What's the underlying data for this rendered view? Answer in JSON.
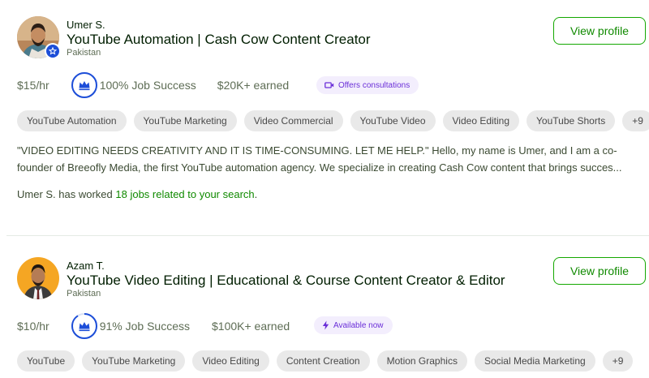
{
  "freelancers": [
    {
      "name": "Umer S.",
      "title": "YouTube Automation | Cash Cow Content Creator",
      "country": "Pakistan",
      "view_profile": "View profile",
      "rate": "$15/hr",
      "job_success": "100% Job Success",
      "earned": "$20K+ earned",
      "highlight": "Offers consultations",
      "highlight_icon": "video-icon",
      "tags": [
        "YouTube Automation",
        "YouTube Marketing",
        "Video Commercial",
        "YouTube Video",
        "Video Editing",
        "YouTube Shorts",
        "+9"
      ],
      "description_line1": "\"VIDEO EDITING NEEDS CREATIVITY AND IT IS TIME-CONSUMING. LET ME HELP.\" Hello, my name is Umer, and I am a co-",
      "description_line2": "founder of Breeofly Media, the first YouTube automation agency. We specialize in creating Cash Cow content that brings succes...",
      "worked_prefix": "Umer S. has worked ",
      "worked_link": "18 jobs related to your search",
      "worked_suffix": ".",
      "avatar_bg": "#c8a27a",
      "verified": true
    },
    {
      "name": "Azam T.",
      "title": "YouTube Video Editing | Educational & Course Content Creator & Editor",
      "country": "Pakistan",
      "view_profile": "View profile",
      "rate": "$10/hr",
      "job_success": "91% Job Success",
      "earned": "$100K+ earned",
      "highlight": "Available now",
      "highlight_icon": "lightning-icon",
      "tags": [
        "YouTube",
        "YouTube Marketing",
        "Video Editing",
        "Content Creation",
        "Motion Graphics",
        "Social Media Marketing",
        "+9"
      ],
      "avatar_bg": "#f5a623",
      "verified": false
    }
  ],
  "colors": {
    "accent": "#14a800",
    "link": "#108a00",
    "highlight_bg": "#f3eefd",
    "highlight_text": "#6b2fd8",
    "tag_bg": "#e9e9e9",
    "job_success_ring": "#1d4ed8"
  }
}
